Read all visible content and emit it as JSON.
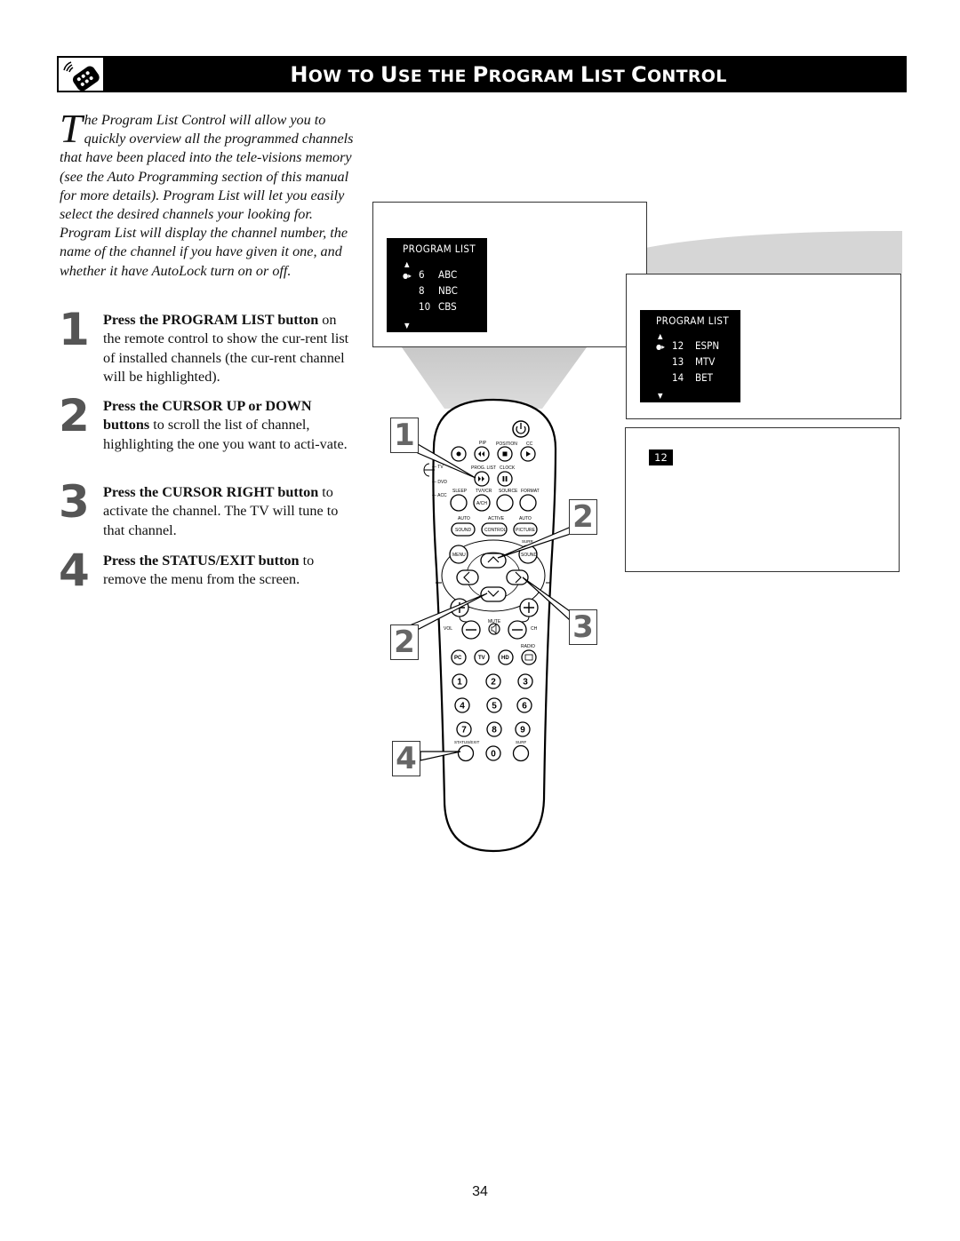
{
  "header": {
    "icon": "remote-control-icon",
    "title_parts": [
      {
        "big": "H",
        "small": "OW TO "
      },
      {
        "big": "U",
        "small": "SE THE "
      },
      {
        "big": "P",
        "small": "ROGRAM "
      },
      {
        "big": "L",
        "small": "IST "
      },
      {
        "big": "C",
        "small": "ONTROL"
      }
    ],
    "title": "How to Use the Program List Control"
  },
  "intro": {
    "dropcap": "T",
    "text": "he Program List Control will allow you to quickly overview all the programmed channels that have been placed into the tele-visions memory (see the Auto Programming section of this manual for more details). Program List will let you easily select the desired channels your looking for. Program List will display the channel number, the name of the channel if you have given it one, and whether it have AutoLock turn on or off."
  },
  "steps": [
    {
      "number": "1",
      "bold": "Press the PROGRAM LIST button",
      "text": " on the remote control to show the cur-rent list of installed channels (the cur-rent channel will be highlighted)."
    },
    {
      "number": "2",
      "bold": "Press the CURSOR UP or DOWN buttons",
      "text": " to scroll the list of channel, highlighting the one you want to acti-vate."
    },
    {
      "number": "3",
      "bold": "Press the CURSOR RIGHT button",
      "text": " to activate the channel. The TV will tune to that channel."
    },
    {
      "number": "4",
      "bold": "Press the STATUS/EXIT button",
      "text": " to remove the menu from the screen."
    }
  ],
  "screens": {
    "first": {
      "title": "PROGRAM LIST",
      "up_arrow": "▲",
      "down_arrow": "▼",
      "pointer": "●▸",
      "rows": [
        {
          "num": "6",
          "name": "ABC",
          "selected": true
        },
        {
          "num": "8",
          "name": "NBC",
          "selected": false
        },
        {
          "num": "10",
          "name": "CBS",
          "selected": false
        }
      ]
    },
    "second": {
      "title": "PROGRAM LIST",
      "up_arrow": "▲",
      "down_arrow": "▼",
      "pointer": "●▸",
      "rows": [
        {
          "num": "12",
          "name": "ESPN",
          "selected": true
        },
        {
          "num": "13",
          "name": "MTV",
          "selected": false
        },
        {
          "num": "14",
          "name": "BET",
          "selected": false
        }
      ]
    },
    "third": {
      "channel": "12"
    }
  },
  "callouts": {
    "c1": "1",
    "c2a": "2",
    "c2b": "2",
    "c3": "3",
    "c4": "4"
  },
  "remote": {
    "labels": {
      "pip": "PIP",
      "position": "POSITION",
      "cc": "CC",
      "prog_list": "PROG. LIST",
      "clock": "CLOCK",
      "tv": "— TV",
      "dvd": "— DVD",
      "acc": "— ACC",
      "sleep": "SLEEP",
      "tvvcr": "TV/VCR",
      "source": "SOURCE",
      "format": "FORMAT",
      "ach": "A/CH",
      "auto1": "AUTO",
      "active": "ACTIVE",
      "auto2": "AUTO",
      "sound": "SOUND",
      "control": "CONTROL",
      "picture": "PICTURE",
      "surr": "SURR",
      "menu": "MENU",
      "surr_sound": "SOUND",
      "mute": "MUTE",
      "vol": "VOL",
      "ch": "CH",
      "radio": "RADIO",
      "pc": "PC",
      "tv_btn": "TV",
      "hd": "HD",
      "status_exit": "STATUS/EXIT",
      "surf": "SURF"
    },
    "digits": [
      "1",
      "2",
      "3",
      "4",
      "5",
      "6",
      "7",
      "8",
      "9",
      "0"
    ]
  },
  "page_number": "34"
}
